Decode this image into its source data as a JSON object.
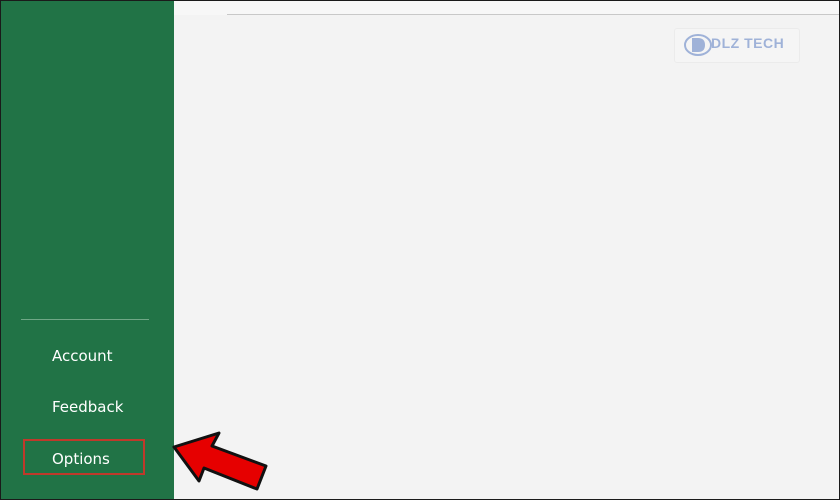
{
  "sidebar": {
    "items": [
      {
        "label": "Account"
      },
      {
        "label": "Feedback"
      },
      {
        "label": "Options"
      }
    ]
  },
  "watermark": {
    "text": "DLZ TECH"
  },
  "annotation": {
    "arrow_color": "#e60000",
    "highlight_color": "#c0392b"
  },
  "colors": {
    "sidebar_bg": "#217346",
    "content_bg": "#f3f3f3"
  }
}
